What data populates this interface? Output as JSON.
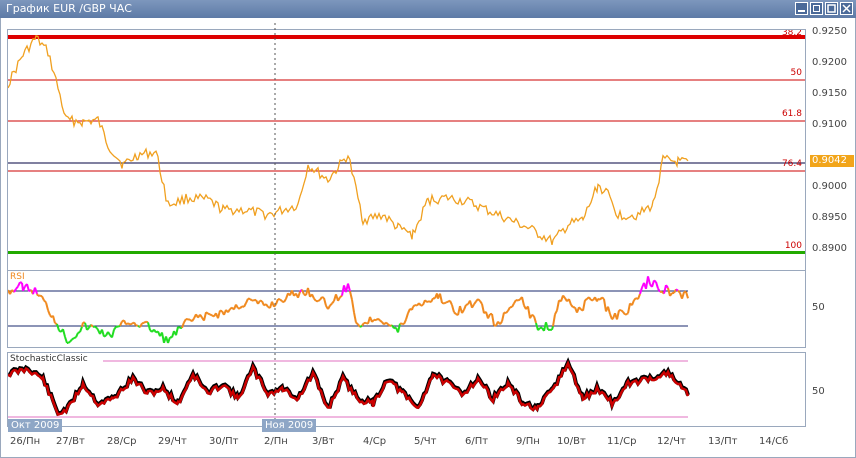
{
  "window": {
    "title": "График EUR /GBP  ЧАС"
  },
  "main_chart": {
    "price_scale": [
      "0.9250",
      "0.9200",
      "0.9150",
      "0.9100",
      "0.9050",
      "0.9000",
      "0.8950",
      "0.8900"
    ],
    "current_price": "0.9042",
    "fib_levels": [
      "38.2",
      "50",
      "61.8",
      "76.4",
      "100"
    ],
    "colors": {
      "price_line": "#f0a020",
      "fib_line": "#cc0000",
      "band_top": "#dd0000",
      "band_bottom": "#22aa00",
      "current_line": "#000040"
    }
  },
  "rsi": {
    "label": "RSI",
    "scale": [
      "50"
    ],
    "colors": {
      "line": "#f08a20",
      "overbought": "#ff00ff",
      "oversold": "#22dd22"
    }
  },
  "stochastic": {
    "label": "StochasticClassic",
    "scale": [
      "50"
    ],
    "colors": {
      "line": "#cc0000",
      "signal": "#000000",
      "level": "#e070c0"
    }
  },
  "time_axis": {
    "months": [
      "Окт 2009",
      "Ноя 2009"
    ],
    "days": [
      "26/Пн",
      "27/Вт",
      "28/Ср",
      "29/Чт",
      "30/Пт",
      "2/Пн",
      "3/Вт",
      "4/Ср",
      "5/Чт",
      "6/Пт",
      "9/Пн",
      "10/Вт",
      "11/Ср",
      "12/Чт",
      "13/Пт",
      "14/Сб"
    ]
  }
}
